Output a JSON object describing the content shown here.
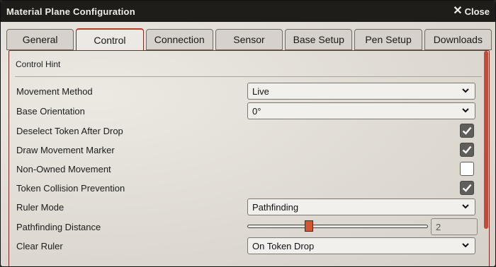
{
  "window": {
    "title": "Material Plane Configuration",
    "close_label": "Close"
  },
  "tabs": [
    {
      "label": "General"
    },
    {
      "label": "Control"
    },
    {
      "label": "Connection"
    },
    {
      "label": "Sensor"
    },
    {
      "label": "Base Setup"
    },
    {
      "label": "Pen Setup"
    },
    {
      "label": "Downloads"
    }
  ],
  "active_tab": "Control",
  "panel": {
    "hint": "Control Hint",
    "settings": {
      "movement_method": {
        "label": "Movement Method",
        "value": "Live"
      },
      "base_orientation": {
        "label": "Base Orientation",
        "value": "0°"
      },
      "deselect_token": {
        "label": "Deselect Token After Drop",
        "checked": true
      },
      "draw_marker": {
        "label": "Draw Movement Marker",
        "checked": true
      },
      "non_owned": {
        "label": "Non-Owned Movement",
        "checked": false
      },
      "collision": {
        "label": "Token Collision Prevention",
        "checked": true
      },
      "ruler_mode": {
        "label": "Ruler Mode",
        "value": "Pathfinding"
      },
      "pathfinding_distance": {
        "label": "Pathfinding Distance",
        "value": "2",
        "slider_fraction": 0.34
      },
      "clear_ruler": {
        "label": "Clear Ruler",
        "value": "On Token Drop"
      }
    }
  },
  "colors": {
    "accent": "#b43e2e",
    "titlebar": "#1f1d1a",
    "slider_handle": "#d2562f"
  }
}
